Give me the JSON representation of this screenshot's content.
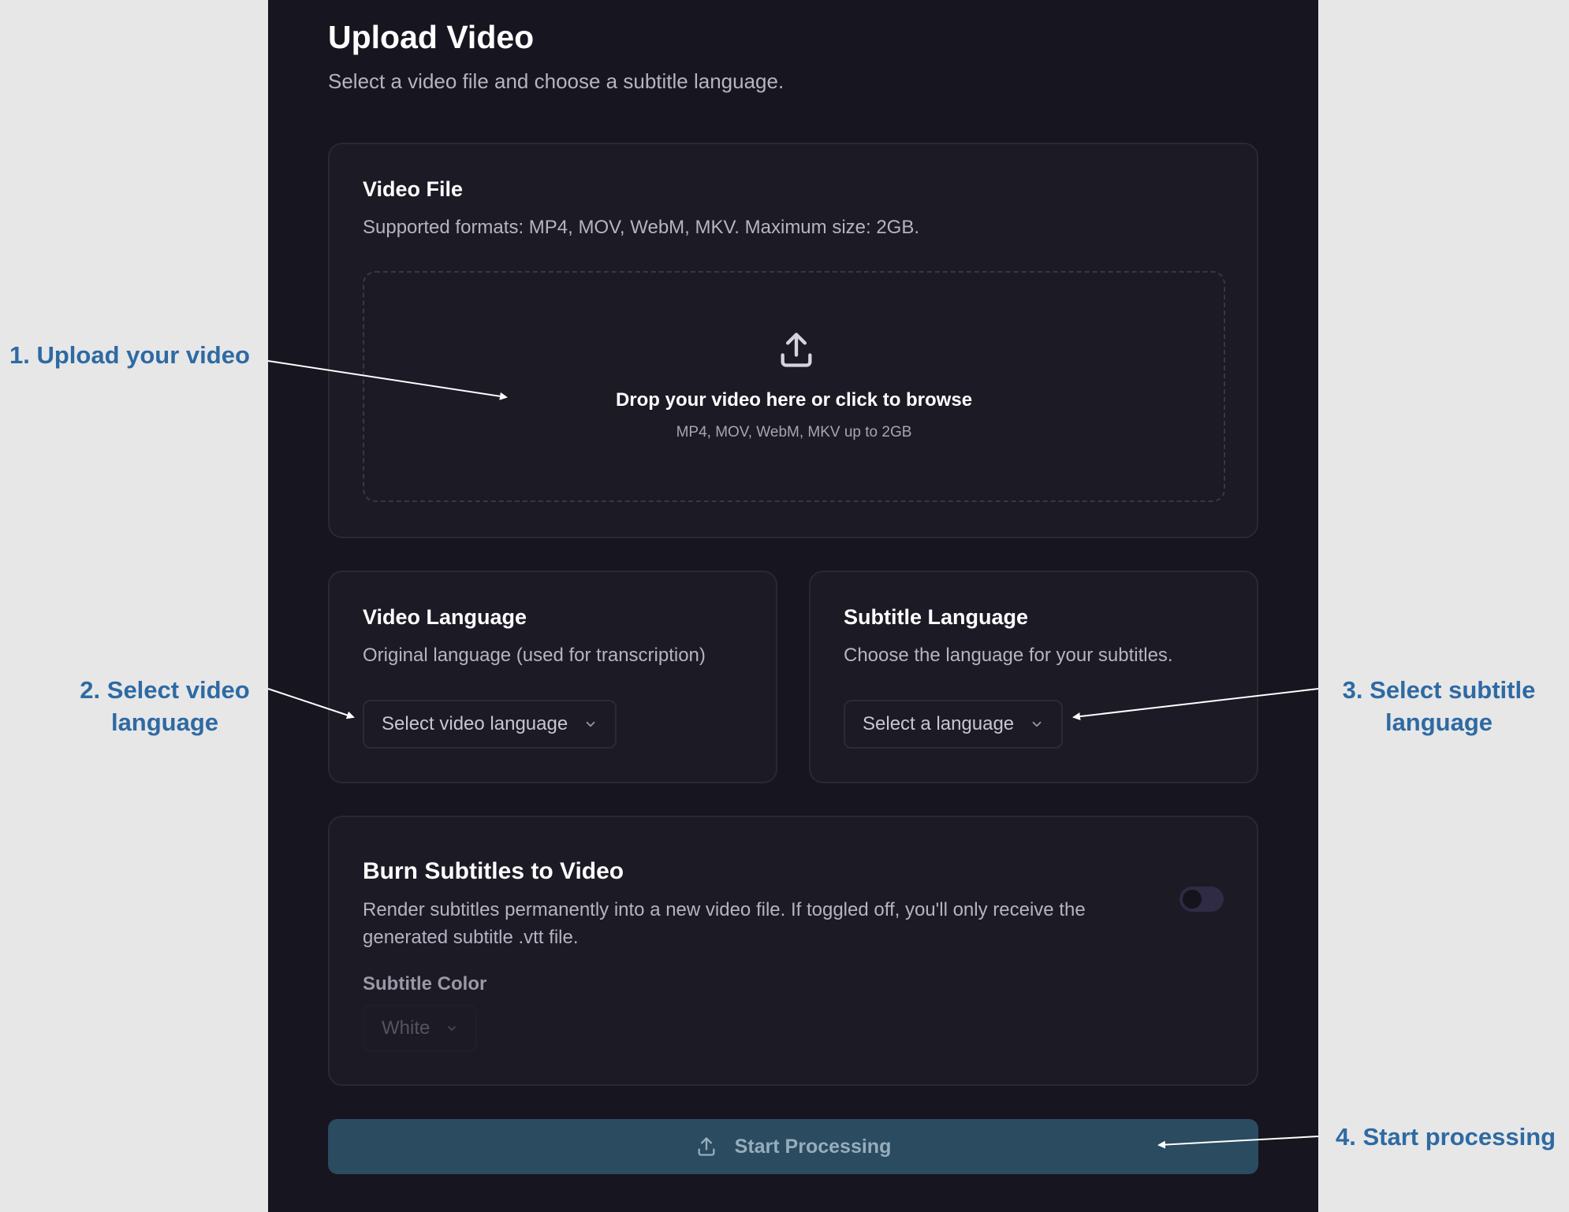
{
  "header": {
    "title": "Upload Video",
    "subtitle": "Select a video file and choose a subtitle language."
  },
  "video_file": {
    "title": "Video File",
    "description": "Supported formats: MP4, MOV, WebM, MKV. Maximum size: 2GB.",
    "dropzone_title": "Drop your video here or click to browse",
    "dropzone_hint": "MP4, MOV, WebM, MKV up to 2GB",
    "icon": "upload-icon"
  },
  "video_language": {
    "title": "Video Language",
    "description": "Original language (used for transcription)",
    "select_placeholder": "Select video language"
  },
  "subtitle_language": {
    "title": "Subtitle Language",
    "description": "Choose the language for your subtitles.",
    "select_placeholder": "Select a language"
  },
  "burn": {
    "title": "Burn Subtitles to Video",
    "description": "Render subtitles permanently into a new video file. If toggled off, you'll only receive the generated subtitle .vtt file.",
    "toggle_on": false,
    "color_label": "Subtitle Color",
    "color_value": "White"
  },
  "start_button": {
    "label": "Start Processing",
    "icon": "upload-icon",
    "disabled": true
  },
  "annotations": {
    "step1": "1. Upload your video",
    "step2": "2. Select video language",
    "step3": "3. Select subtitle language",
    "step4": "4. Start processing"
  },
  "colors": {
    "panel_bg": "#17151f",
    "card_bg": "#1c1a25",
    "annotation": "#2e6aa3",
    "button_bg": "#2a4b60"
  }
}
